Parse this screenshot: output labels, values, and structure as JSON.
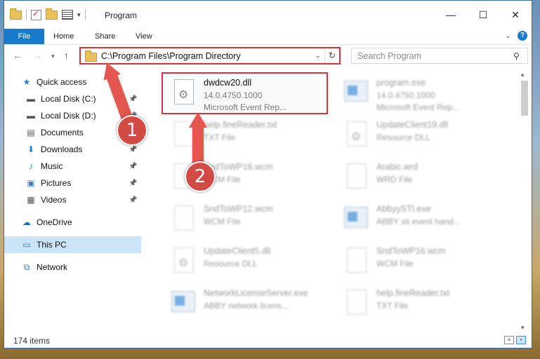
{
  "window": {
    "title": "Program"
  },
  "ribbon": {
    "tabs": [
      "File",
      "Home",
      "Share",
      "View"
    ]
  },
  "address": {
    "path": "C:\\Program Files\\Program Directory"
  },
  "search": {
    "placeholder": "Search Program"
  },
  "sidebar": {
    "items": [
      {
        "label": "Quick access",
        "icon": "star-icon",
        "pinned": false
      },
      {
        "label": "Local Disk (C:)",
        "icon": "drive-icon",
        "pinned": true
      },
      {
        "label": "Local Disk (D:)",
        "icon": "drive-icon",
        "pinned": true
      },
      {
        "label": "Documents",
        "icon": "document-icon",
        "pinned": true
      },
      {
        "label": "Downloads",
        "icon": "download-icon",
        "pinned": true
      },
      {
        "label": "Music",
        "icon": "music-icon",
        "pinned": true
      },
      {
        "label": "Pictures",
        "icon": "picture-icon",
        "pinned": true
      },
      {
        "label": "Videos",
        "icon": "video-icon",
        "pinned": true
      },
      {
        "label": "OneDrive",
        "icon": "cloud-icon",
        "pinned": false
      },
      {
        "label": "This PC",
        "icon": "computer-icon",
        "pinned": false,
        "selected": true
      },
      {
        "label": "Network",
        "icon": "network-icon",
        "pinned": false
      }
    ]
  },
  "files": [
    {
      "name": "dwdcw20.dll",
      "line1": "14.0.4750.1000",
      "line2": "Microsoft Event Rep...",
      "icon": "dll-icon",
      "highlighted": true
    },
    {
      "name": "program.exe",
      "line1": "14.0.4750.1000",
      "line2": "Microsoft Event Rep...",
      "icon": "app-icon"
    },
    {
      "name": "help.fineReader.txt",
      "line1": "TXT File",
      "line2": "",
      "icon": "text-file-icon"
    },
    {
      "name": "UpdateClient19.dll",
      "line1": "Resource DLL",
      "line2": "",
      "icon": "dll-icon"
    },
    {
      "name": "SndToWP16.wcm",
      "line1": "WCM File",
      "line2": "",
      "icon": "file-icon"
    },
    {
      "name": "Arabic.wrd",
      "line1": "WRD File",
      "line2": "",
      "icon": "file-icon"
    },
    {
      "name": "SndToWP12.wcm",
      "line1": "WCM File",
      "line2": "",
      "icon": "file-icon"
    },
    {
      "name": "AbbyySTI.exe",
      "line1": "ABBY sti event hand...",
      "line2": "",
      "icon": "app-icon"
    },
    {
      "name": "UpdateClient5.dll",
      "line1": "Resource DLL",
      "line2": "",
      "icon": "dll-icon"
    },
    {
      "name": "SndToWP16.wcm",
      "line1": "WCM File",
      "line2": "",
      "icon": "file-icon"
    },
    {
      "name": "NetworkLicenseServer.exe",
      "line1": "ABBY network licens...",
      "line2": "",
      "icon": "app-icon"
    },
    {
      "name": "help.fineReader.txt",
      "line1": "TXT File",
      "line2": "",
      "icon": "text-file-icon"
    }
  ],
  "status": {
    "items_count": "174 items"
  },
  "annotations": {
    "step1": "1",
    "step2": "2"
  },
  "colors": {
    "accent": "#1979ca",
    "highlight": "#d9343b",
    "annotation": "#e4574f"
  }
}
